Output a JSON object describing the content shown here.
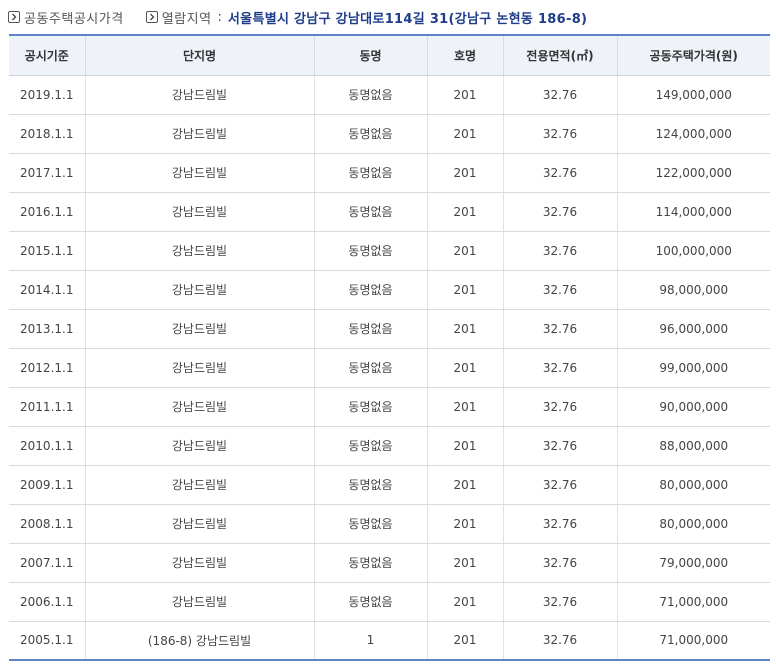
{
  "breadcrumb": {
    "section_label": "공동주택공시가격",
    "location_label": "열람지역",
    "separator": ":",
    "location_value": "서울특별시 강남구 강남대로114길 31(강남구 논현동 186-8)"
  },
  "table": {
    "headers": [
      "공시기준",
      "단지명",
      "동명",
      "호명",
      "전용면적(㎡)",
      "공동주택가격(원)"
    ],
    "rows": [
      [
        "2019.1.1",
        "강남드림빌",
        "동명없음",
        "201",
        "32.76",
        "149,000,000"
      ],
      [
        "2018.1.1",
        "강남드림빌",
        "동명없음",
        "201",
        "32.76",
        "124,000,000"
      ],
      [
        "2017.1.1",
        "강남드림빌",
        "동명없음",
        "201",
        "32.76",
        "122,000,000"
      ],
      [
        "2016.1.1",
        "강남드림빌",
        "동명없음",
        "201",
        "32.76",
        "114,000,000"
      ],
      [
        "2015.1.1",
        "강남드림빌",
        "동명없음",
        "201",
        "32.76",
        "100,000,000"
      ],
      [
        "2014.1.1",
        "강남드림빌",
        "동명없음",
        "201",
        "32.76",
        "98,000,000"
      ],
      [
        "2013.1.1",
        "강남드림빌",
        "동명없음",
        "201",
        "32.76",
        "96,000,000"
      ],
      [
        "2012.1.1",
        "강남드림빌",
        "동명없음",
        "201",
        "32.76",
        "99,000,000"
      ],
      [
        "2011.1.1",
        "강남드림빌",
        "동명없음",
        "201",
        "32.76",
        "90,000,000"
      ],
      [
        "2010.1.1",
        "강남드림빌",
        "동명없음",
        "201",
        "32.76",
        "88,000,000"
      ],
      [
        "2009.1.1",
        "강남드림빌",
        "동명없음",
        "201",
        "32.76",
        "80,000,000"
      ],
      [
        "2008.1.1",
        "강남드림빌",
        "동명없음",
        "201",
        "32.76",
        "80,000,000"
      ],
      [
        "2007.1.1",
        "강남드림빌",
        "동명없음",
        "201",
        "32.76",
        "79,000,000"
      ],
      [
        "2006.1.1",
        "강남드림빌",
        "동명없음",
        "201",
        "32.76",
        "71,000,000"
      ],
      [
        "2005.1.1",
        "(186-8) 강남드림빌",
        "1",
        "201",
        "32.76",
        "71,000,000"
      ]
    ]
  },
  "colors": {
    "accent": "#5b85c8",
    "header_bg": "#eff3f9",
    "location_text": "#1f3d8a"
  },
  "icons": {
    "breadcrumb_marker": "chevron-right-box-icon"
  }
}
